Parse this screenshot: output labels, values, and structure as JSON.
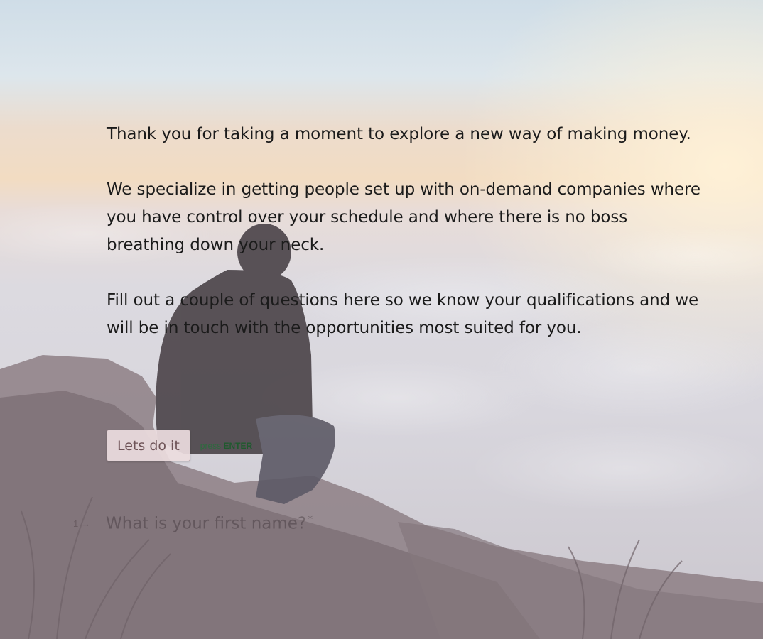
{
  "welcome": {
    "paragraphs": [
      "Thank you for taking a moment to explore a new way of making money.",
      "We specialize in getting people set up with on-demand companies where you have control over your schedule and where there is no boss breathing down your neck.",
      "Fill out a couple of questions here so we know your qualifications and we will be in touch with the opportunities most suited for you."
    ],
    "button_label": "Lets do it",
    "hint_prefix": "press",
    "hint_key": "ENTER"
  },
  "question": {
    "number": "1",
    "arrow_icon": "arrow-right-icon",
    "text": "What is your first name?",
    "required_mark": "*"
  },
  "colors": {
    "button_bg": "#ecdcde",
    "button_text": "#6e5357",
    "hint": "#2d6a3e"
  }
}
